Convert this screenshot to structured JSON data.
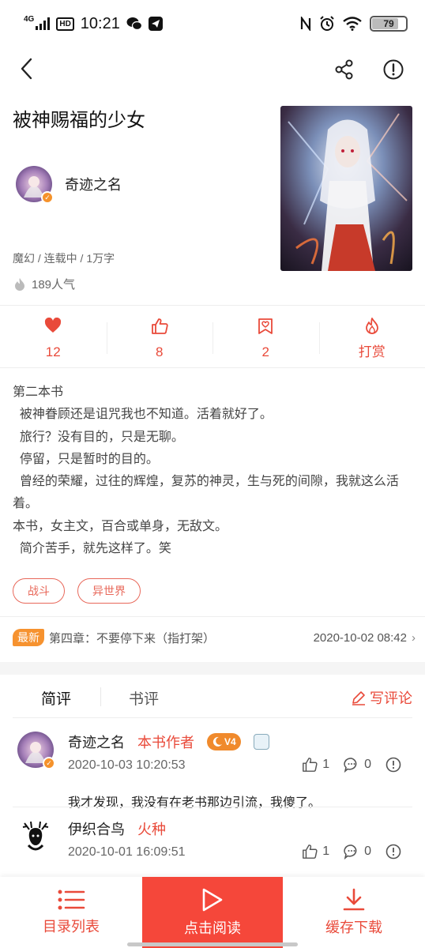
{
  "status_bar": {
    "time": "10:21",
    "network": "4G",
    "hd": "HD",
    "battery": "79",
    "battery_level": 0.79
  },
  "book": {
    "title": "被神赐福的少女",
    "author": "奇迹之名",
    "meta": "魔幻 / 连载中 / 1万字",
    "popularity": "189人气"
  },
  "stats": [
    {
      "icon": "heart-icon",
      "value": "12"
    },
    {
      "icon": "thumbs-up-icon",
      "value": "8"
    },
    {
      "icon": "bookmark-heart-icon",
      "value": "2"
    },
    {
      "icon": "flame-icon",
      "value": "打赏"
    }
  ],
  "description": "第二本书\n  被神眷顾还是诅咒我也不知道。活着就好了。\n  旅行？没有目的，只是无聊。\n  停留，只是暂时的目的。\n  曾经的荣耀，过往的辉煌，复苏的神灵，生与死的间隙，我就这么活着。\n本书，女主文，百合或单身，无敌文。\n  简介苦手，就先这样了。笑",
  "tags": [
    "战斗",
    "异世界"
  ],
  "latest_chapter": {
    "badge": "最新",
    "title": "第四章：不要停下来（指打架）",
    "time": "2020-10-02 08:42"
  },
  "comment_tabs": {
    "active": "简评",
    "inactive": "书评",
    "write": "写评论"
  },
  "comments": [
    {
      "name": "奇迹之名",
      "role": "本书作者",
      "level": "V4",
      "date": "2020-10-03 10:20:53",
      "likes": "1",
      "replies": "0",
      "text": "我才发现，我没有在老书那边引流，我傻了。"
    },
    {
      "name": "伊织合鸟",
      "role": "火种",
      "date": "2020-10-01 16:09:51",
      "likes": "1",
      "replies": "0"
    }
  ],
  "bottom_bar": {
    "catalog": "目录列表",
    "read": "点击阅读",
    "download": "缓存下载"
  },
  "colors": {
    "accent": "#e94a3a",
    "read_button": "#f5473a",
    "badge": "#f6922f"
  }
}
